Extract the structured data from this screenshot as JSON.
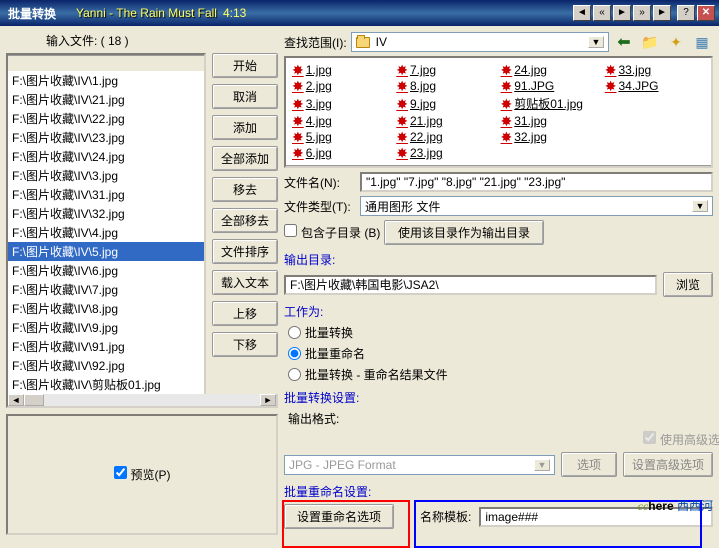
{
  "title": "批量转换",
  "song": "Yanni - The Rain Must Fall",
  "songtime": "4:13",
  "inputfiles_label": "输入文件: ( 18 )",
  "files": [
    "F:\\图片收藏\\IV\\1.jpg",
    "F:\\图片收藏\\IV\\21.jpg",
    "F:\\图片收藏\\IV\\22.jpg",
    "F:\\图片收藏\\IV\\23.jpg",
    "F:\\图片收藏\\IV\\24.jpg",
    "F:\\图片收藏\\IV\\3.jpg",
    "F:\\图片收藏\\IV\\31.jpg",
    "F:\\图片收藏\\IV\\32.jpg",
    "F:\\图片收藏\\IV\\4.jpg",
    "F:\\图片收藏\\IV\\5.jpg",
    "F:\\图片收藏\\IV\\6.jpg",
    "F:\\图片收藏\\IV\\7.jpg",
    "F:\\图片收藏\\IV\\8.jpg",
    "F:\\图片收藏\\IV\\9.jpg",
    "F:\\图片收藏\\IV\\91.jpg",
    "F:\\图片收藏\\IV\\92.jpg",
    "F:\\图片收藏\\IV\\剪贴板01.jpg"
  ],
  "selected_index": 9,
  "buttons": {
    "start": "开始",
    "cancel": "取消",
    "add": "添加",
    "addall": "全部添加",
    "remove": "移去",
    "removeall": "全部移去",
    "sort": "文件排序",
    "loadtxt": "载入文本",
    "moveup": "上移",
    "movedown": "下移"
  },
  "preview_label": "预览(P)",
  "lookin_label": "查找范围(I):",
  "lookin_value": "IV",
  "grid_files": [
    "1.jpg",
    "7.jpg",
    "24.jpg",
    "33.jpg",
    "2.jpg",
    "8.jpg",
    "91.JPG",
    "34.JPG",
    "3.jpg",
    "9.jpg",
    "剪贴板01.jpg",
    "",
    "4.jpg",
    "21.jpg",
    "31.jpg",
    "",
    "5.jpg",
    "22.jpg",
    "32.jpg",
    "",
    "6.jpg",
    "23.jpg",
    "",
    ""
  ],
  "filename_label": "文件名(N):",
  "filename_value": "\"1.jpg\" \"7.jpg\" \"8.jpg\" \"21.jpg\" \"23.jpg\"",
  "filetype_label": "文件类型(T):",
  "filetype_value": "通用图形 文件",
  "include_sub": "包含子目录 (B)",
  "use_dir_btn": "使用该目录作为输出目录",
  "outputdir_label": "输出目录:",
  "outputdir_value": "F:\\图片收藏\\韩国电影\\JSA2\\",
  "browse": "浏览",
  "workas_label": "工作为:",
  "radio1": "批量转换",
  "radio2": "批量重命名",
  "radio3": "批量转换 - 重命名结果文件",
  "convset_label": "批量转换设置:",
  "outfmt_label": "输出格式:",
  "useadv": "使用高级选项",
  "jpgfmt": "JPG - JPEG Format",
  "options": "选项",
  "setadv": "设置高级选项",
  "renset_label": "批量重命名设置:",
  "setren": "设置重命名选项",
  "nametpl_label": "名称模板:",
  "nametpl_value": "image###",
  "watermark": {
    "cc": "cc",
    "here": "here",
    "cn": " 西西河"
  }
}
